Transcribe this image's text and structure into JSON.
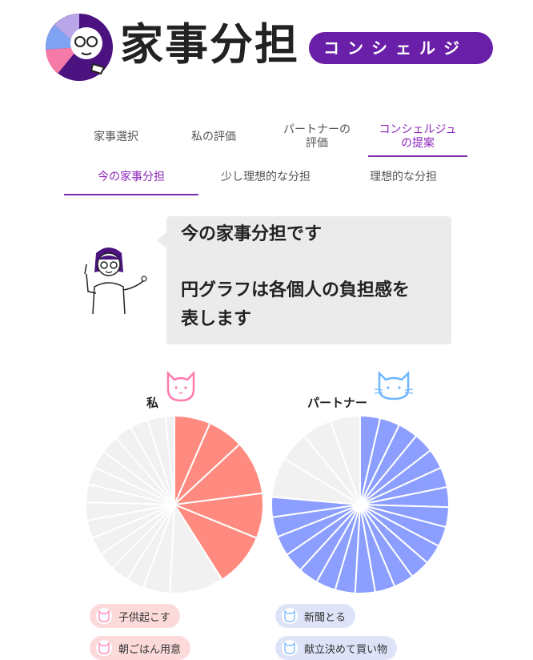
{
  "header": {
    "title": "家事分担",
    "badge": "コンシェルジュ"
  },
  "steps": [
    {
      "label": "家事選択",
      "active": false
    },
    {
      "label": "私の評価",
      "active": false
    },
    {
      "label": "パートナーの評価",
      "active": false
    },
    {
      "label": "コンシェルジュの提案",
      "active": true
    }
  ],
  "subtabs": [
    {
      "label": "今の家事分担",
      "active": true
    },
    {
      "label": "少し理想的な分担",
      "active": false
    },
    {
      "label": "理想的な分担",
      "active": false
    }
  ],
  "bubble": {
    "line1": "今の家事分担です",
    "line2": "円グラフは各個人の負担感を",
    "line3": "表します"
  },
  "charts": {
    "me": {
      "label": "私",
      "color": "#ff8a80"
    },
    "partner": {
      "label": "パートナー",
      "color": "#8c9eff"
    }
  },
  "legend": {
    "me": [
      "子供起こす",
      "朝ごはん用意"
    ],
    "partner": [
      "新聞とる",
      "献立決めて買い物"
    ]
  },
  "colors": {
    "accent": "#7b2ab0",
    "pie_empty": "#f1f1f1",
    "me": "#ff8a80",
    "partner": "#8c9eff"
  },
  "chart_data": [
    {
      "type": "pie",
      "title": "私",
      "slices": [
        {
          "value": 4,
          "filled": true
        },
        {
          "value": 4,
          "filled": true
        },
        {
          "value": 6,
          "filled": true
        },
        {
          "value": 5,
          "filled": true
        },
        {
          "value": 6,
          "filled": true
        },
        {
          "value": 6,
          "filled": false
        },
        {
          "value": 3,
          "filled": false
        },
        {
          "value": 2,
          "filled": false
        },
        {
          "value": 2,
          "filled": false
        },
        {
          "value": 2,
          "filled": false
        },
        {
          "value": 2,
          "filled": false
        },
        {
          "value": 2,
          "filled": false
        },
        {
          "value": 2,
          "filled": false
        },
        {
          "value": 2,
          "filled": false
        },
        {
          "value": 2,
          "filled": false
        },
        {
          "value": 2,
          "filled": false
        },
        {
          "value": 2,
          "filled": false
        },
        {
          "value": 2,
          "filled": false
        },
        {
          "value": 2,
          "filled": false
        },
        {
          "value": 2,
          "filled": false
        },
        {
          "value": 1,
          "filled": false
        }
      ]
    },
    {
      "type": "pie",
      "title": "パートナー",
      "slices": [
        {
          "value": 2,
          "filled": true
        },
        {
          "value": 2,
          "filled": true
        },
        {
          "value": 2,
          "filled": true
        },
        {
          "value": 2,
          "filled": true
        },
        {
          "value": 2,
          "filled": true
        },
        {
          "value": 2,
          "filled": true
        },
        {
          "value": 2,
          "filled": true
        },
        {
          "value": 2,
          "filled": true
        },
        {
          "value": 2,
          "filled": true
        },
        {
          "value": 2,
          "filled": true
        },
        {
          "value": 2,
          "filled": true
        },
        {
          "value": 2,
          "filled": true
        },
        {
          "value": 2,
          "filled": true
        },
        {
          "value": 2,
          "filled": true
        },
        {
          "value": 2,
          "filled": true
        },
        {
          "value": 2,
          "filled": true
        },
        {
          "value": 2,
          "filled": true
        },
        {
          "value": 2,
          "filled": true
        },
        {
          "value": 2,
          "filled": true
        },
        {
          "value": 2,
          "filled": true
        },
        {
          "value": 2,
          "filled": true
        },
        {
          "value": 4,
          "filled": false
        },
        {
          "value": 3,
          "filled": false
        },
        {
          "value": 3,
          "filled": false
        },
        {
          "value": 3,
          "filled": false
        }
      ]
    }
  ]
}
